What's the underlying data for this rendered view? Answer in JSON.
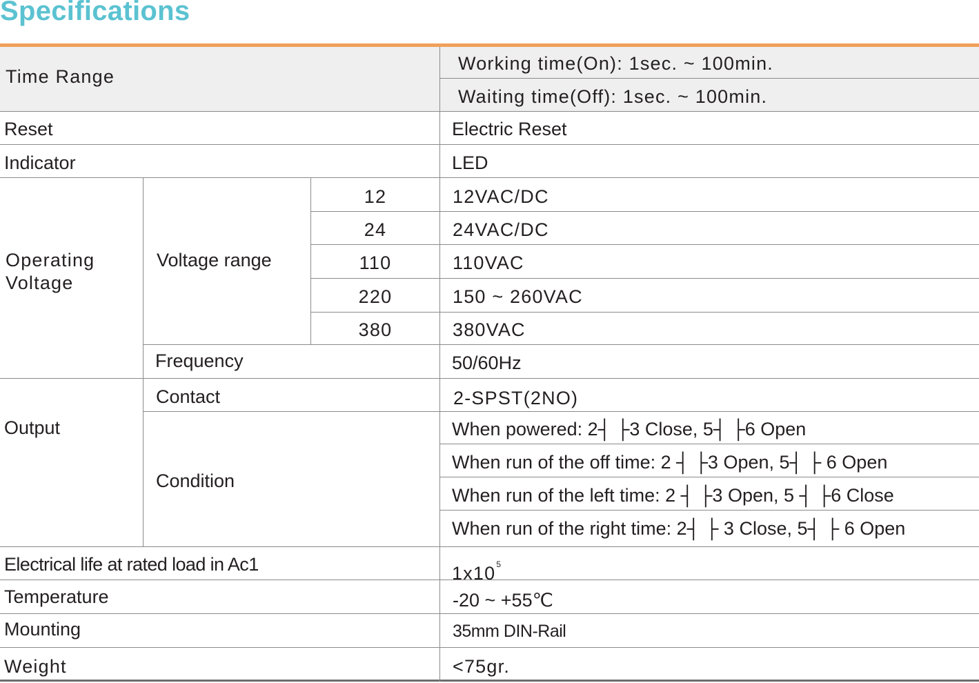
{
  "title": "Specifications",
  "rows": {
    "time_range": {
      "label": "Time Range",
      "on": "Working time(On): 1sec. ~ 100min.",
      "off": "Waiting time(Off): 1sec. ~ 100min."
    },
    "reset": {
      "label": "Reset",
      "value": "Electric Reset"
    },
    "indicator": {
      "label": "Indicator",
      "value": "LED"
    },
    "operating_voltage": {
      "label_line1": "Operating",
      "label_line2": "Voltage",
      "voltage_range_label": "Voltage range",
      "voltage_rows": [
        {
          "code": "12",
          "value": "12VAC/DC"
        },
        {
          "code": "24",
          "value": "24VAC/DC"
        },
        {
          "code": "110",
          "value": "110VAC"
        },
        {
          "code": "220",
          "value": "150 ~ 260VAC"
        },
        {
          "code": "380",
          "value": "380VAC"
        }
      ],
      "frequency_label": "Frequency",
      "frequency_value": "50/60Hz"
    },
    "output": {
      "label": "Output",
      "contact_label": "Contact",
      "contact_value": "2-SPST(2NO)",
      "condition_label": "Condition",
      "conditions": [
        "When powered: 2┤ ├3 Close, 5┤ ├6 Open",
        "When run of the off time: 2 ┤ ├3 Open, 5┤ ├ 6 Open",
        "When run of the left time: 2 ┤ ├3 Open, 5 ┤ ├6 Close",
        "When run of the right time: 2┤ ├ 3 Close, 5┤ ├ 6 Open"
      ]
    },
    "electrical_life": {
      "label": "Electrical life at rated load in Ac1",
      "value": "1x10",
      "exponent": "5"
    },
    "temperature": {
      "label": "Temperature",
      "value": "-20 ~ +55℃"
    },
    "mounting": {
      "label": "Mounting",
      "value": "35mm DIN-Rail"
    },
    "weight": {
      "label": "Weight",
      "value": "<75gr."
    }
  },
  "colors": {
    "title": "#5bc2d1",
    "accent_rule": "#f0a05a",
    "shade": "#efefef",
    "line": "#8a8a8a"
  }
}
